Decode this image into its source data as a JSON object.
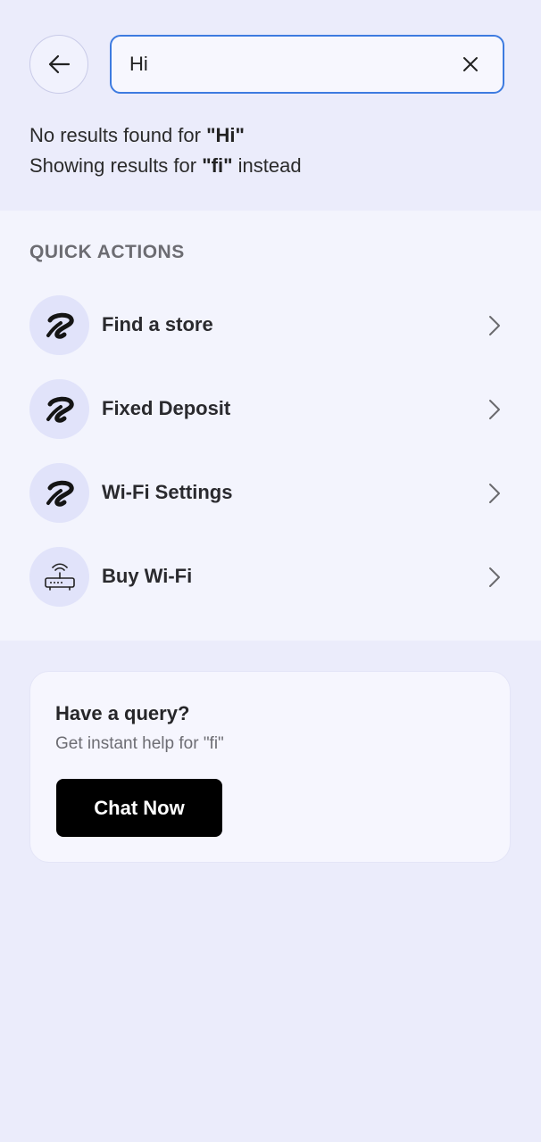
{
  "search": {
    "value": "Hi"
  },
  "messages": {
    "no_results_prefix": "No results found for ",
    "no_results_query": "\"Hi\"",
    "showing_prefix": "Showing results for ",
    "showing_query": "\"fi\"",
    "showing_suffix": " instead"
  },
  "quick_actions": {
    "title": "QUICK ACTIONS",
    "items": [
      {
        "label": "Find a store",
        "icon": "airtel-logo-icon"
      },
      {
        "label": "Fixed Deposit",
        "icon": "airtel-logo-icon"
      },
      {
        "label": "Wi-Fi Settings",
        "icon": "airtel-logo-icon"
      },
      {
        "label": "Buy Wi-Fi",
        "icon": "wifi-router-icon"
      }
    ]
  },
  "query_card": {
    "title": "Have a query?",
    "subtitle": "Get instant help for \"fi\"",
    "button_label": "Chat Now"
  },
  "colors": {
    "background": "#ebecfb",
    "section_bg": "#f3f4fd",
    "accent_border": "#3d7be0",
    "button_bg": "#000000"
  }
}
